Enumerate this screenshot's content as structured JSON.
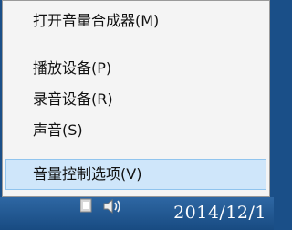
{
  "context_menu": {
    "items": [
      {
        "label": "打开音量合成器(M)"
      },
      {
        "label": "播放设备(P)"
      },
      {
        "label": "录音设备(R)"
      },
      {
        "label": "声音(S)"
      },
      {
        "label": "音量控制选项(V)",
        "highlighted": true
      }
    ]
  },
  "taskbar": {
    "tray_icons": [
      "volume-speaker-icon"
    ],
    "clock_date": "2014/12/1"
  },
  "colors": {
    "menu_background": "#f4f4f4",
    "highlight": "#cfe6fa",
    "taskbar": "#1f5a96"
  }
}
